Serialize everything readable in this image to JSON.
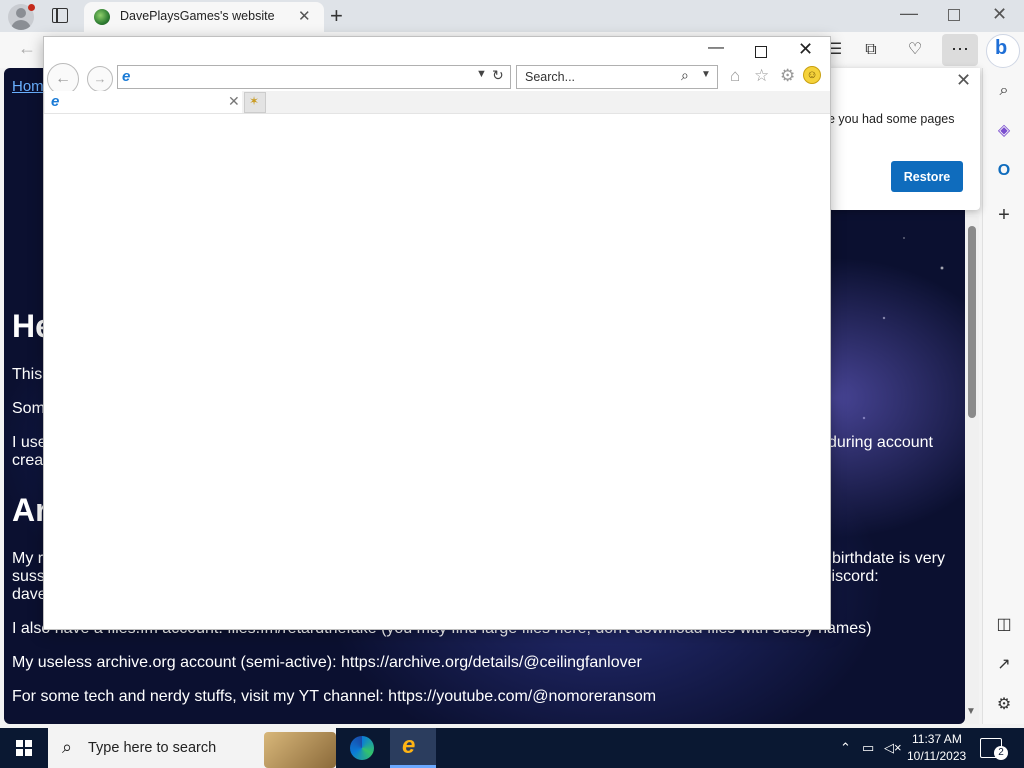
{
  "edge": {
    "tab_title": "DavePlaysGames's website",
    "more_glyph": "⋯",
    "bing_glyph": "b"
  },
  "page": {
    "home_link": "Hom",
    "heading1": "He",
    "line_this": "This",
    "line_som": "Som",
    "line_iuse_left": "I use",
    "line_iuse_right": "during account",
    "line_crea": "crea",
    "heading2": "Ar",
    "line_my_left": "My r",
    "line_my_right": "birthdate is very",
    "line_suss": "suss",
    "line_discord_right": "liscord:",
    "line_dave": "dave",
    "line_files": "I also have a files.fm account: files.fm/retardthefake (you may find large files here, don't download files with sussy names)",
    "line_archive": "My useless archive.org account (semi-active): https://archive.org/details/@ceilingfanlover",
    "line_yt": "For some tech and nerdy stuffs, visit my YT channel: https://youtube.com/@nomoreransom"
  },
  "restore_popup": {
    "message": "e you had some pages",
    "restore_label": "Restore"
  },
  "ie": {
    "search_placeholder": "Search..."
  },
  "taskbar": {
    "search_placeholder": "Type here to search",
    "clock_time": "11:37 AM",
    "clock_date": "10/11/2023",
    "notification_count": "2"
  }
}
